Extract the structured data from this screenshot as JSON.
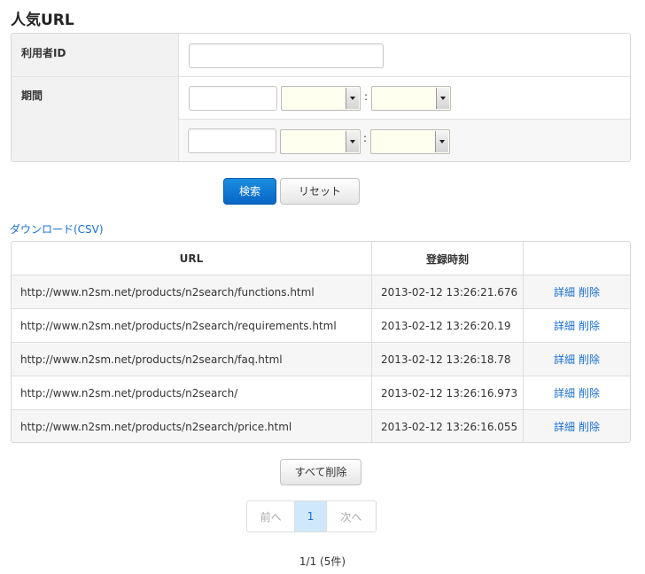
{
  "page": {
    "title": "人気URL"
  },
  "form": {
    "user_id_label": "利用者ID",
    "period_label": "期間",
    "colon": ":"
  },
  "buttons": {
    "search": "検索",
    "reset": "リセット",
    "delete_all": "すべて削除"
  },
  "download": {
    "label": "ダウンロード(CSV)"
  },
  "table": {
    "headers": [
      "URL",
      "登録時刻",
      ""
    ],
    "rows": [
      {
        "url": "http://www.n2sm.net/products/n2search/functions.html",
        "time": "2013-02-12 13:26:21.676",
        "detail": "詳細",
        "delete": "削除"
      },
      {
        "url": "http://www.n2sm.net/products/n2search/requirements.html",
        "time": "2013-02-12 13:26:20.19",
        "detail": "詳細",
        "delete": "削除"
      },
      {
        "url": "http://www.n2sm.net/products/n2search/faq.html",
        "time": "2013-02-12 13:26:18.78",
        "detail": "詳細",
        "delete": "削除"
      },
      {
        "url": "http://www.n2sm.net/products/n2search/",
        "time": "2013-02-12 13:26:16.973",
        "detail": "詳細",
        "delete": "削除"
      },
      {
        "url": "http://www.n2sm.net/products/n2search/price.html",
        "time": "2013-02-12 13:26:16.055",
        "detail": "詳細",
        "delete": "削除"
      }
    ]
  },
  "pagination": {
    "prev": "前へ",
    "current": "1",
    "next": "次へ",
    "summary": "1/1 (5件)"
  },
  "colors": {
    "primary": "#0a77d5",
    "link": "#1a6fd1",
    "select_bg": "#fffff0",
    "active_page_bg": "#cfe8fb"
  }
}
